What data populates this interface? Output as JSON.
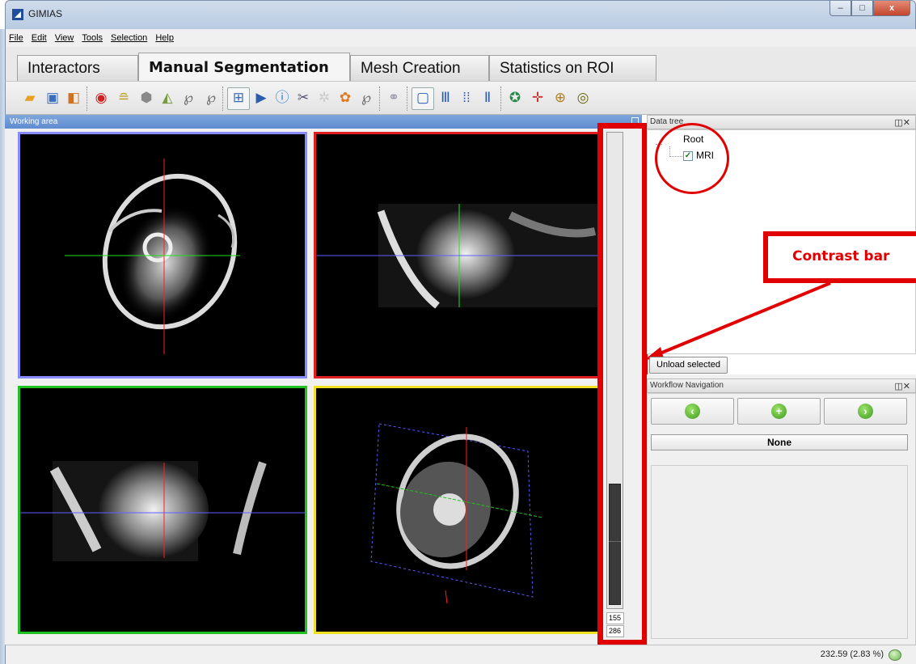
{
  "window": {
    "title": "GIMIAS"
  },
  "menu": [
    {
      "label": "File"
    },
    {
      "label": "Edit"
    },
    {
      "label": "View"
    },
    {
      "label": "Tools"
    },
    {
      "label": "Selection"
    },
    {
      "label": "Help"
    }
  ],
  "tabs": [
    {
      "label": "Interactors",
      "active": false
    },
    {
      "label": "Manual Segmentation",
      "active": true
    },
    {
      "label": "Mesh Creation",
      "active": false
    },
    {
      "label": "Statistics on ROI",
      "active": false
    }
  ],
  "working_area": {
    "title": "Working area"
  },
  "viewports": {
    "border_colors": [
      "#8a8aff",
      "#e02020",
      "#22c022",
      "#f0e020"
    ],
    "crosshair_colors": {
      "red": "#ff2020",
      "green": "#20e020",
      "blue": "#6060ff"
    }
  },
  "contrast": {
    "upper_value": "155",
    "lower_value": "286"
  },
  "data_tree": {
    "title": "Data tree",
    "root_label": "Root",
    "child_label": "MRI",
    "child_checked": true,
    "unload_button": "Unload selected"
  },
  "annotation": {
    "callout_text": "Contrast bar"
  },
  "workflow": {
    "title": "Workflow Navigation",
    "current": "None",
    "buttons": [
      {
        "icon": "arrow-left-icon"
      },
      {
        "icon": "plus-icon"
      },
      {
        "icon": "arrow-right-icon"
      }
    ]
  },
  "status": {
    "text": "232.59  (2.83 %)"
  }
}
